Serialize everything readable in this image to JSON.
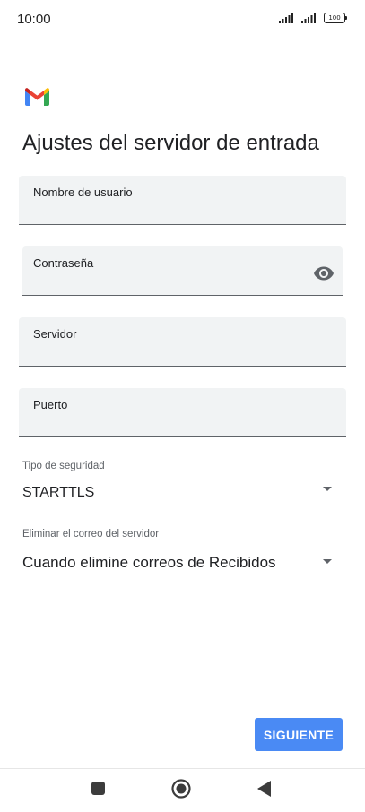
{
  "status_bar": {
    "time": "10:00",
    "battery": "100"
  },
  "logo": {
    "icon": "gmail-logo-icon",
    "colors": [
      "#ea4335",
      "#4285f4",
      "#34a853",
      "#fbbc04"
    ]
  },
  "page": {
    "title": "Ajustes del servidor de entrada"
  },
  "fields": {
    "username": {
      "label": "Nombre de usuario",
      "value": ""
    },
    "password": {
      "label": "Contraseña",
      "value": "",
      "icon": "eye-icon"
    },
    "server": {
      "label": "Servidor",
      "value": ""
    },
    "port": {
      "label": "Puerto",
      "value": ""
    }
  },
  "security": {
    "caption": "Tipo de seguridad",
    "selected": "STARTTLS"
  },
  "delete_mail": {
    "caption": "Eliminar el correo del servidor",
    "selected": "Cuando elimine correos de Recibidos"
  },
  "actions": {
    "next_label": "SIGUIENTE",
    "accent_color": "#4a8af4"
  },
  "navigation": {
    "recents": "recents-square-icon",
    "home": "home-circle-icon",
    "back": "back-triangle-icon"
  }
}
